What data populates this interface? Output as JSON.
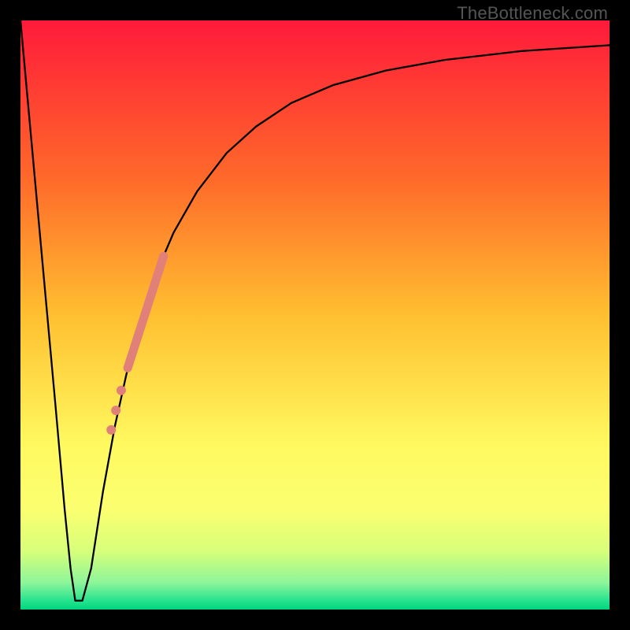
{
  "watermark": "TheBottleneck.com",
  "chart_data": {
    "type": "line",
    "title": "",
    "xlabel": "",
    "ylabel": "",
    "xlim": [
      0,
      100
    ],
    "ylim": [
      0,
      100
    ],
    "gradient_stops": [
      {
        "offset": 0,
        "color": "#ff1a3a"
      },
      {
        "offset": 0.27,
        "color": "#ff6a2a"
      },
      {
        "offset": 0.5,
        "color": "#ffbf30"
      },
      {
        "offset": 0.72,
        "color": "#fff960"
      },
      {
        "offset": 0.83,
        "color": "#fbff70"
      },
      {
        "offset": 0.9,
        "color": "#d8ff7a"
      },
      {
        "offset": 0.955,
        "color": "#8cf59a"
      },
      {
        "offset": 0.985,
        "color": "#26e28e"
      },
      {
        "offset": 1.0,
        "color": "#00d67e"
      }
    ],
    "series": [
      {
        "name": "bottleneck-curve",
        "stroke": "#000000",
        "stroke_width": 2.3,
        "x": [
          0.0,
          2.0,
          4.0,
          6.0,
          7.5,
          8.5,
          9.3,
          10.5,
          12.0,
          14.0,
          16.0,
          18.0,
          20.0,
          23.0,
          26.0,
          30.0,
          35.0,
          40.0,
          46.0,
          53.0,
          62.0,
          72.0,
          85.0,
          100.0
        ],
        "y": [
          100,
          78,
          56,
          34,
          17,
          7,
          1.5,
          1.5,
          7,
          20,
          31,
          40,
          48,
          57,
          64,
          71,
          77.5,
          82,
          86,
          89,
          91.5,
          93.3,
          94.8,
          95.8
        ]
      }
    ],
    "markers": [
      {
        "name": "highlight-bar",
        "type": "rounded-segment",
        "color": "#e18079",
        "width": 11,
        "cap": "round",
        "x1": 18.2,
        "y1": 41.0,
        "x2": 24.3,
        "y2": 60.0
      },
      {
        "name": "dot-1",
        "type": "circle",
        "color": "#e18079",
        "r": 6.0,
        "cx": 17.1,
        "cy": 37.2
      },
      {
        "name": "dot-2",
        "type": "circle",
        "color": "#e18079",
        "r": 6.0,
        "cx": 16.2,
        "cy": 33.8
      },
      {
        "name": "dot-3",
        "type": "circle",
        "color": "#e18079",
        "r": 6.0,
        "cx": 15.4,
        "cy": 30.5
      }
    ]
  }
}
